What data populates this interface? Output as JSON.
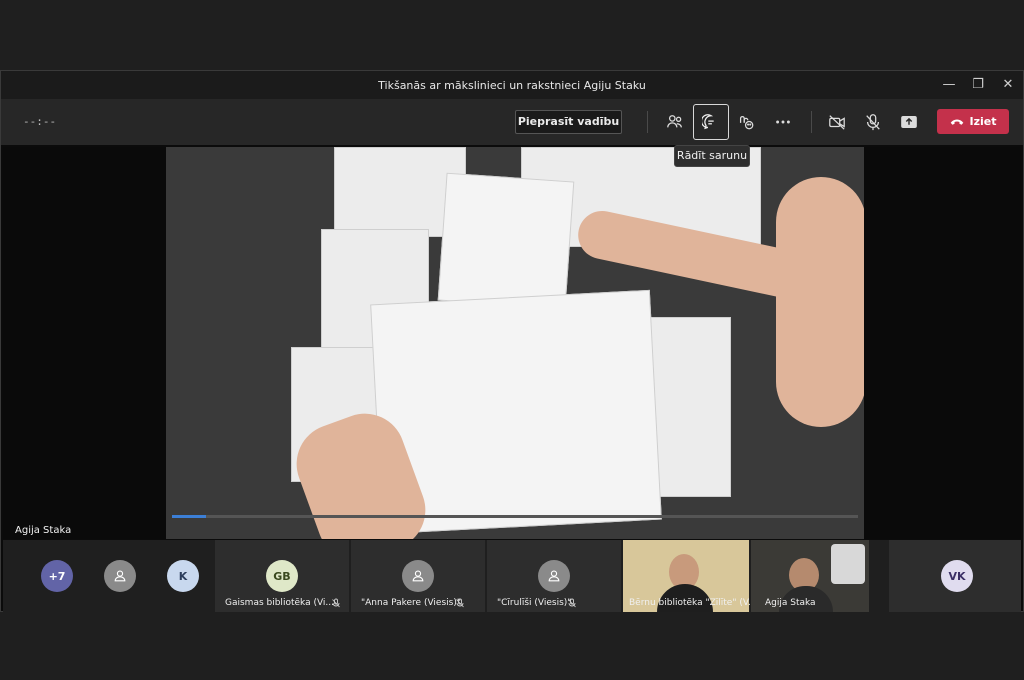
{
  "window": {
    "title": "Tikšanās ar mākslinieci un rakstnieci Agiju Staku"
  },
  "toolbar": {
    "timer": "--:--",
    "request_control_label": "Pieprasīt vadību",
    "leave_label": "Iziet",
    "chat_tooltip": "Rādīt sarunu"
  },
  "stage": {
    "presenter_name": "Agija Staka"
  },
  "participants": {
    "overflow_count": "+7",
    "k_initial": "K",
    "gb": {
      "initials": "GB",
      "label": "Gaismas bibliotēka (Vi..."
    },
    "anna": {
      "label": "\"Anna Pakere (Viesis)\""
    },
    "cirulisi": {
      "label": "\"Cīrulīši (Viesis)\""
    },
    "bernu": {
      "label": "Bērnu bibliotēka \"Zīlīte\" (V..."
    },
    "agija": {
      "label": "Agija Staka"
    },
    "vk": {
      "initials": "VK"
    }
  },
  "colors": {
    "leave": "#c4314b",
    "accent": "#6264a7",
    "progress": "#3c7fd6"
  }
}
